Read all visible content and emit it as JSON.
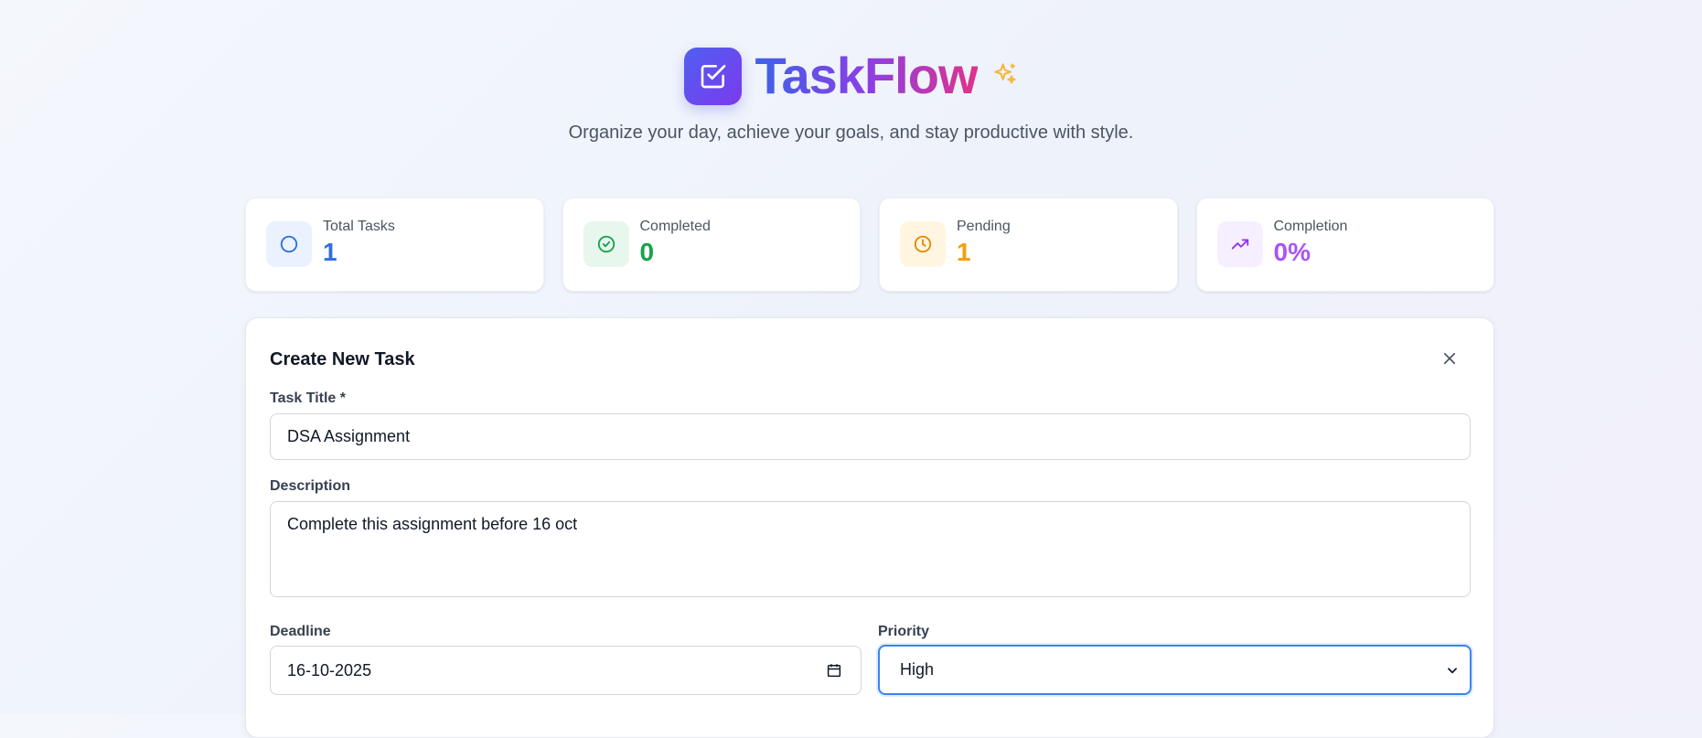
{
  "app": {
    "name": "TaskFlow",
    "tagline": "Organize your day, achieve your goals, and stay productive with style."
  },
  "stats": [
    {
      "label": "Total Tasks",
      "value": "1",
      "icon": "circle-icon",
      "color": "#2f6fe0",
      "bg": "#eaf2ff"
    },
    {
      "label": "Completed",
      "value": "0",
      "icon": "check-circle-icon",
      "color": "#16a34a",
      "bg": "#e8f7ee"
    },
    {
      "label": "Pending",
      "value": "1",
      "icon": "clock-icon",
      "color": "#f59e0b",
      "bg": "#fff5e0"
    },
    {
      "label": "Completion",
      "value": "0%",
      "icon": "trending-up-icon",
      "color": "#a855f7",
      "bg": "#f6efff"
    }
  ],
  "form": {
    "title": "Create New Task",
    "title_label": "Task Title *",
    "title_value": "DSA Assignment",
    "description_label": "Description",
    "description_value": "Complete this assignment before 16 oct",
    "deadline_label": "Deadline",
    "deadline_value": "16-10-2025",
    "priority_label": "Priority",
    "priority_value": "High"
  }
}
